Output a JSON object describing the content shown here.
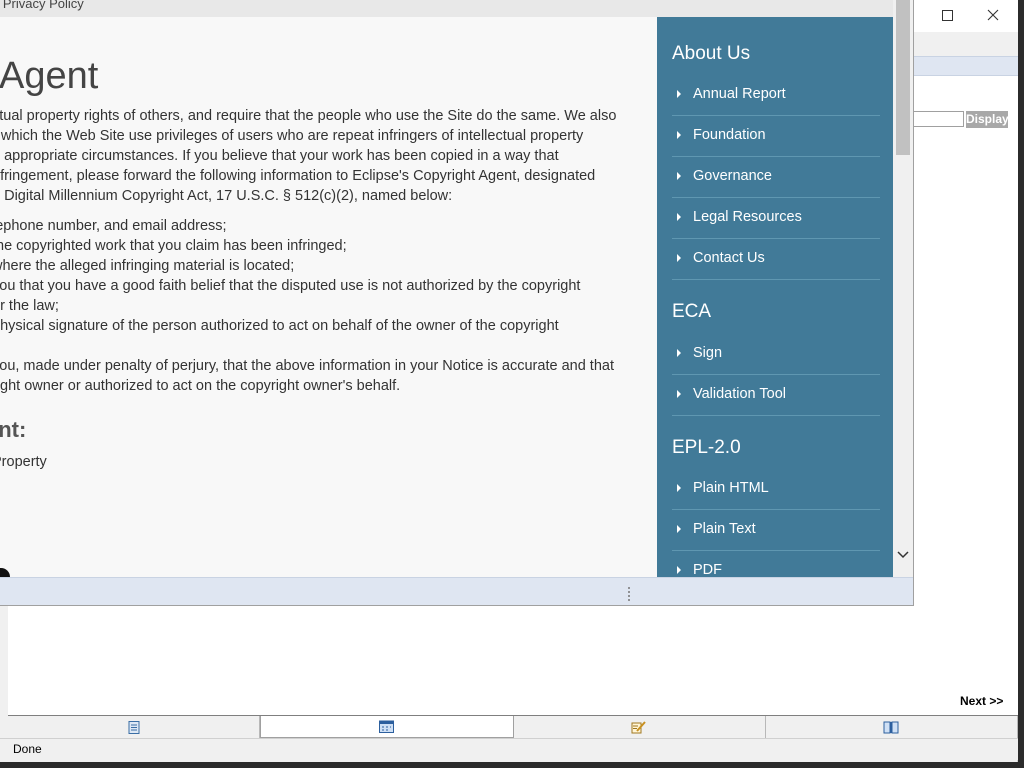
{
  "background_window": {
    "display_button": "Display",
    "next_link": "Next >>",
    "status_text": "Done",
    "tabs": [
      {
        "icon": "document-icon"
      },
      {
        "icon": "calendar-icon"
      },
      {
        "icon": "edit-icon"
      },
      {
        "icon": "book-icon"
      }
    ]
  },
  "popup": {
    "top_bar_text": "g Privacy Policy",
    "heading": "t Agent",
    "paragraph_lines": [
      "ctual property rights of others, and require that the people who use the Site do the same. We also",
      "r which the Web Site use privileges of users who are repeat infringers of intellectual property",
      "n appropriate circumstances. If you believe that your work has been copied in a way that",
      "nfringement, please forward the following information to Eclipse's Copyright Agent, designated",
      "e Digital Millennium Copyright Act, 17 U.S.C. § 512(c)(2), named below:"
    ],
    "list_lines": [
      "lephone number, and email address;",
      "the copyrighted work that you claim has been infringed;",
      "where the alleged infringing material is located;",
      "you that you have a good faith belief that the disputed use is not authorized by the copyright",
      " or the law;",
      "physical signature of the person authorized to act on behalf of the owner of the copyright",
      "",
      "you, made under penalty of perjury, that the above information in your Notice is accurate and that",
      "right owner or authorized to act on the copyright owner's behalf."
    ],
    "agent_heading": "ent:",
    "agent_lines": [
      "Property",
      ".",
      "e"
    ]
  },
  "sidebar": {
    "sections": [
      {
        "heading": "About Us",
        "items": [
          "Annual Report",
          "Foundation",
          "Governance",
          "Legal Resources",
          "Contact Us"
        ]
      },
      {
        "heading": "ECA",
        "items": [
          "Sign",
          "Validation Tool"
        ]
      },
      {
        "heading": "EPL-2.0",
        "items": [
          "Plain HTML",
          "Plain Text",
          "PDF"
        ]
      }
    ]
  }
}
